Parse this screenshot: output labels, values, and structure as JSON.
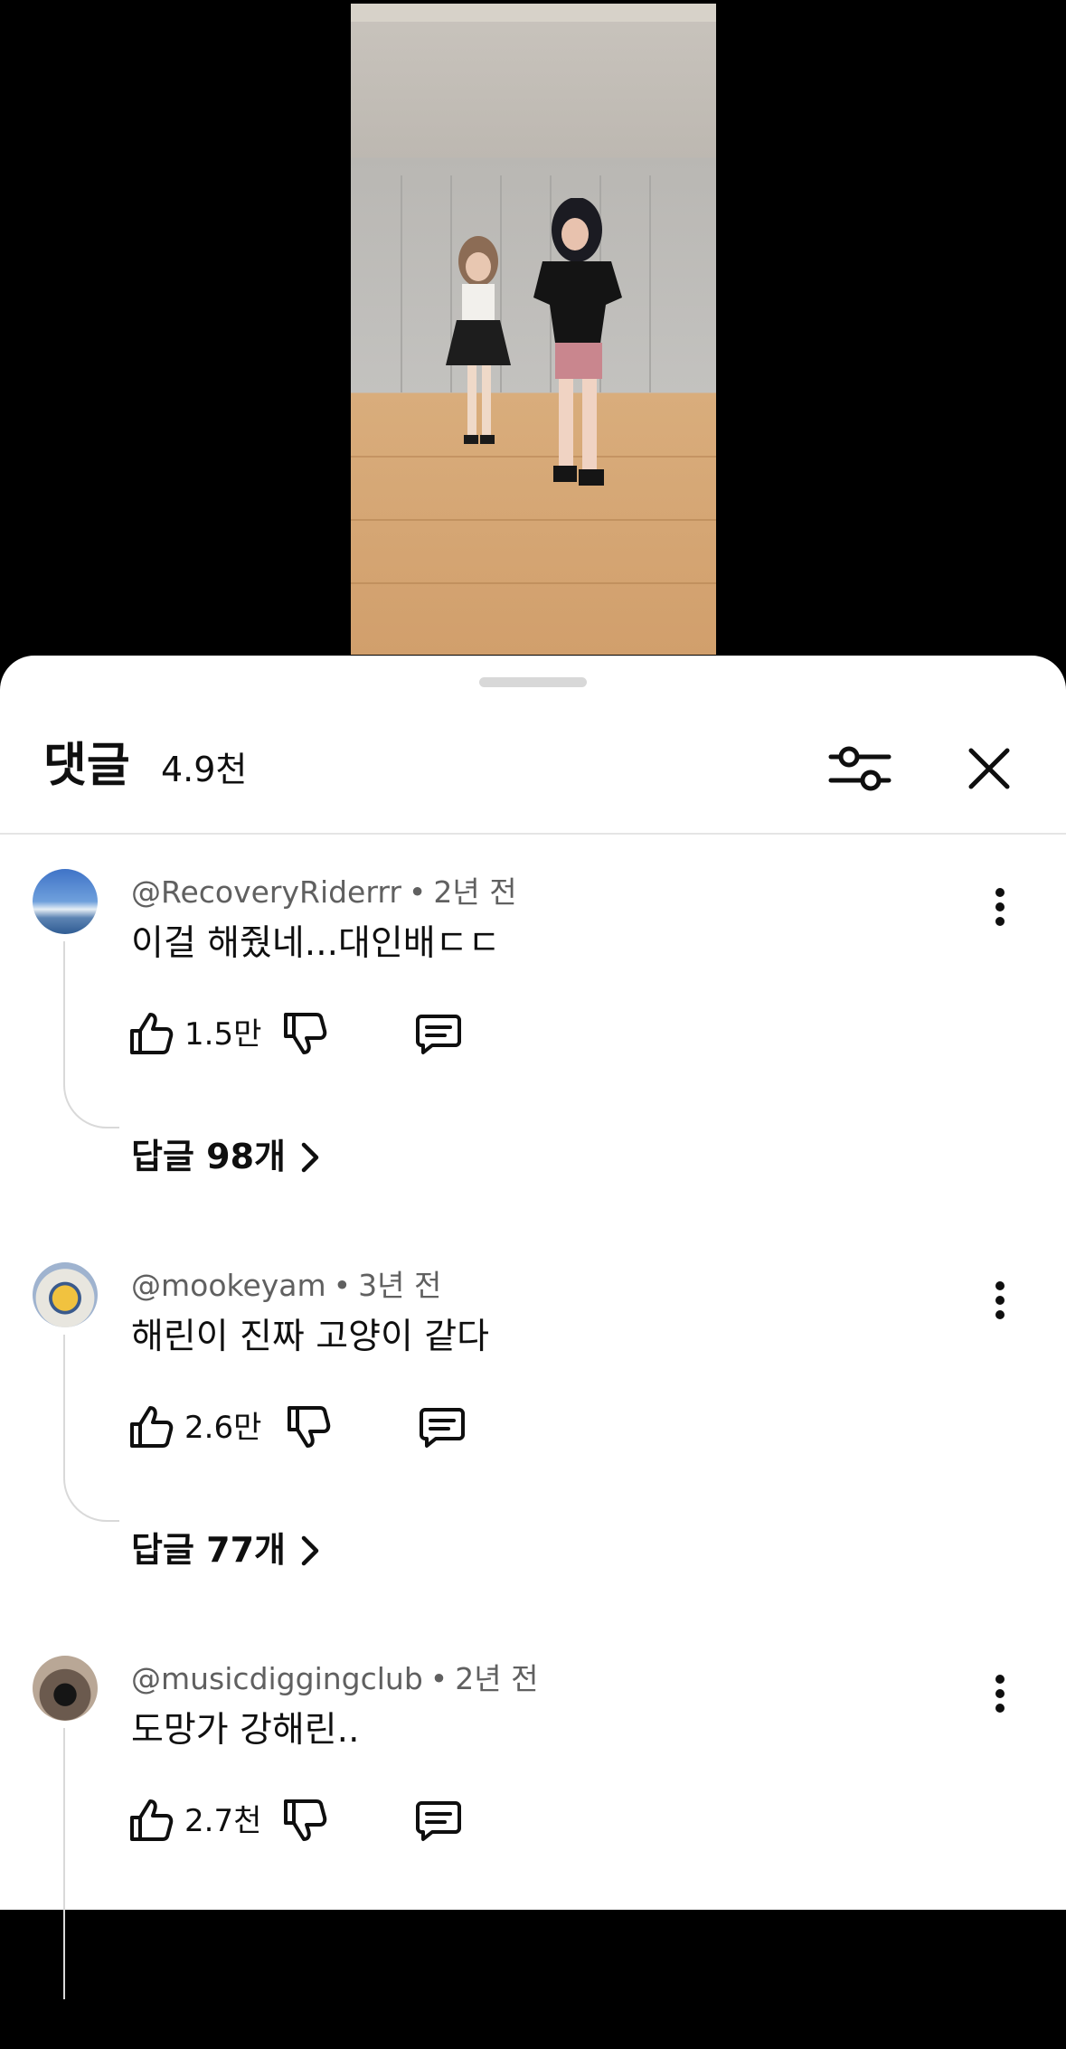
{
  "video": {
    "description_icon": "video-frame"
  },
  "comments_panel": {
    "title": "댓글",
    "count": "4.9천",
    "filter_icon": "sliders-icon",
    "close_icon": "close-icon"
  },
  "comments": [
    {
      "author": "@RecoveryRiderrr",
      "separator": "•",
      "time": "2년 전",
      "text": "이걸 해줬네...대인배ㄷㄷ",
      "likes": "1.5만",
      "replies": "답글 98개"
    },
    {
      "author": "@mookeyam",
      "separator": "•",
      "time": "3년 전",
      "text": "해린이 진짜 고양이 같다",
      "likes": "2.6만",
      "replies": "답글 77개"
    },
    {
      "author": "@musicdiggingclub",
      "separator": "•",
      "time": "2년 전",
      "text": "도망가 강해린..",
      "likes": "2.7천",
      "replies": ""
    }
  ],
  "colors": {
    "accent_text": "#0f0f0f",
    "secondary_text": "#606060",
    "sheet_bg": "#ffffff",
    "backdrop": "#000000"
  }
}
